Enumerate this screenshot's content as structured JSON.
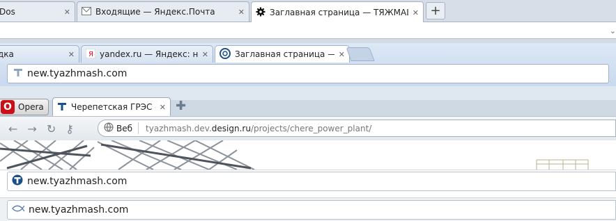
{
  "firefox": {
    "tabs": [
      {
        "label": "Dos"
      },
      {
        "label": "Входящие — Яндекс.Почта"
      },
      {
        "label": "Заглавная страница — ТЯЖМАШ"
      }
    ],
    "new_tab": "+"
  },
  "chrome": {
    "tabs": [
      {
        "label": "дка"
      },
      {
        "label": "yandex.ru — Яндекс: наш"
      },
      {
        "label": "Заглавная страница — Т"
      }
    ],
    "url": "new.tyazhmash.com"
  },
  "opera": {
    "menu_label": "Opera",
    "tab_label": "Черепетская ГРЭС — ...",
    "web_label": "Веб",
    "url_host_prefix": "tyazhmash.dev.",
    "url_host_domain": "design.ru",
    "url_path": "/projects/chere_power_plant/"
  },
  "row5": {
    "url": "new.tyazhmash.com"
  },
  "row6": {
    "url": "new.tyazhmash.com"
  },
  "colors": {
    "opera_red": "#cc0f16",
    "favicon_blue": "#1a4f8a"
  }
}
